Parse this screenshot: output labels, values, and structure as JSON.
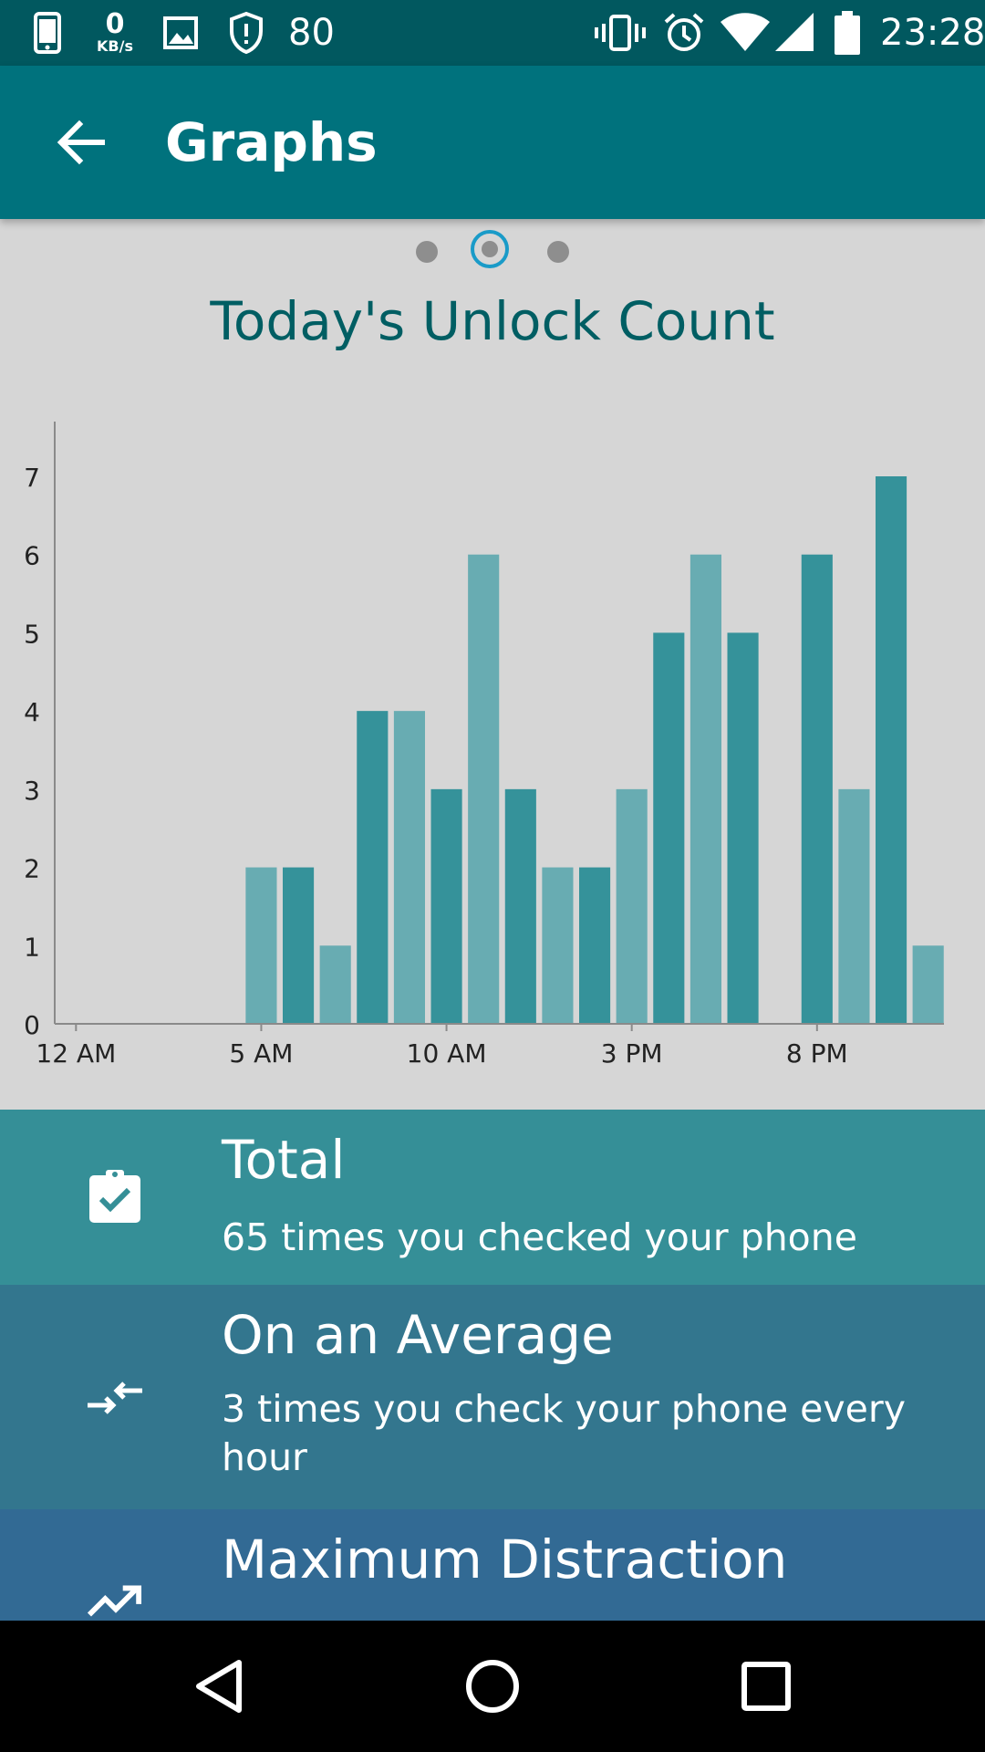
{
  "status_bar": {
    "net_speed_value": "0",
    "net_speed_unit": "KB/s",
    "shield_count": "80",
    "time": "23:28",
    "icons": [
      "phone-icon",
      "gallery-icon",
      "shield-icon",
      "vibrate-icon",
      "alarm-icon",
      "wifi-icon",
      "signal-icon",
      "battery-icon"
    ]
  },
  "app_bar": {
    "title": "Graphs",
    "back_icon": "arrow-back-icon"
  },
  "pager": {
    "pages": 3,
    "selected": 2
  },
  "chart": {
    "title": "Today's Unlock Count"
  },
  "chart_data": {
    "type": "bar",
    "title": "Today's Unlock Count",
    "xlabel": "",
    "ylabel": "",
    "x_tick_labels": [
      "12 AM",
      "5 AM",
      "10 AM",
      "3 PM",
      "8 PM"
    ],
    "y_ticks": [
      "0",
      "1",
      "2",
      "3",
      "4",
      "5",
      "6",
      "7"
    ],
    "ylim": [
      0,
      7.7
    ],
    "hours": [
      0,
      1,
      2,
      3,
      4,
      5,
      6,
      7,
      8,
      9,
      10,
      11,
      12,
      13,
      14,
      15,
      16,
      17,
      18,
      19,
      20,
      21,
      22,
      23
    ],
    "values": [
      0,
      0,
      0,
      0,
      0,
      2,
      2,
      1,
      4,
      4,
      3,
      6,
      3,
      2,
      2,
      3,
      5,
      6,
      5,
      0,
      6,
      3,
      7,
      1
    ],
    "colors": [
      "#35929a",
      "#68acb2"
    ],
    "grid": false
  },
  "summary": {
    "total": {
      "icon": "clipboard-check-icon",
      "heading": "Total",
      "text": "65 times you checked your phone",
      "color": "#358f97"
    },
    "average": {
      "icon": "compress-arrows-icon",
      "heading": "On an Average",
      "text": "3 times you check your phone every hour",
      "color": "#33768e"
    },
    "maximum": {
      "icon": "trending-up-icon",
      "heading": "Maximum Distraction",
      "color": "#326a94"
    }
  },
  "nav_bar": {
    "icons": [
      "back-triangle-icon",
      "home-circle-icon",
      "recents-square-icon"
    ]
  }
}
